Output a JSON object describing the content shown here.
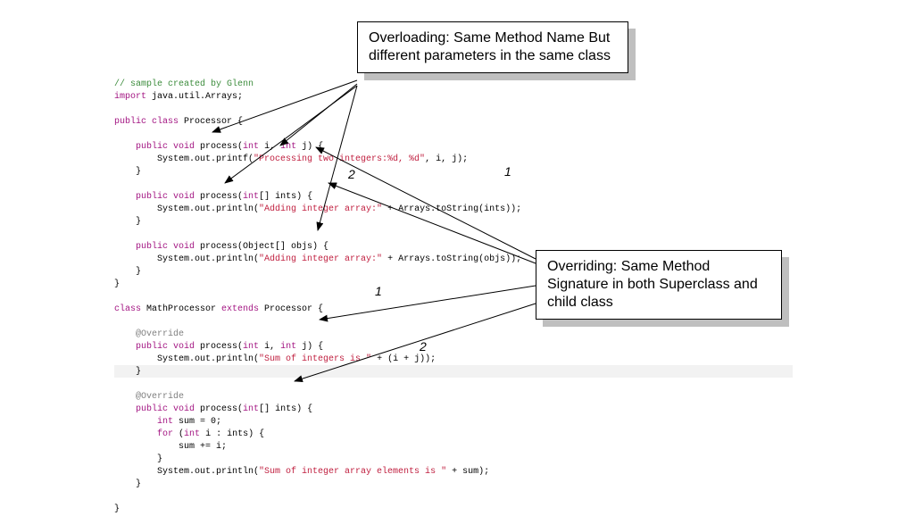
{
  "callouts": {
    "overloading": "Overloading: Same Method Name But different parameters in the same class",
    "overriding": "Overriding: Same Method Signature in both Superclass and child class"
  },
  "labels": {
    "arrow1a": "1",
    "arrow2a": "2",
    "arrow1b": "1",
    "arrow2b": "2"
  },
  "code": {
    "l1_comment": "// sample created by Glenn",
    "l2_import": "import",
    "l2_pkg": " java.util.Arrays;",
    "l4_pub": "public",
    "l4_class": " class",
    "l4_name": " Processor {",
    "l6_pub": "    public",
    "l6_void": " void",
    "l6_sig": " process(",
    "l6_int1": "int",
    "l6_p1": " i, ",
    "l6_int2": "int",
    "l6_p2": " j) {",
    "l7_pre": "        System.out.printf(",
    "l7_str": "\"Processing two integers:%d, %d\"",
    "l7_post": ", i, j);",
    "l8_close": "    }",
    "l10_pub": "    public",
    "l10_void": " void",
    "l10_sig": " process(",
    "l10_int": "int",
    "l10_arr": "[] ints) {",
    "l11_pre": "        System.out.println(",
    "l11_str": "\"Adding integer array:\"",
    "l11_post": " + Arrays.toString(ints));",
    "l12_close": "    }",
    "l14_pub": "    public",
    "l14_void": " void",
    "l14_sig": " process(Object[] objs) {",
    "l15_pre": "        System.out.println(",
    "l15_str": "\"Adding integer array:\"",
    "l15_post": " + Arrays.toString(objs));",
    "l16_close": "    }",
    "l17_close": "}",
    "l19_class": "class",
    "l19_name": " MathProcessor ",
    "l19_ext": "extends",
    "l19_sup": " Processor {",
    "l21_ann": "    @Override",
    "l22_pub": "    public",
    "l22_void": " void",
    "l22_sig": " process(",
    "l22_int1": "int",
    "l22_p1": " i, ",
    "l22_int2": "int",
    "l22_p2": " j) {",
    "l23_pre": "        System.out.println(",
    "l23_str": "\"Sum of integers is \"",
    "l23_post": " + (i + j));",
    "l24_close": "    }",
    "l26_ann": "    @Override",
    "l27_pub": "    public",
    "l27_void": " void",
    "l27_sig": " process(",
    "l27_int": "int",
    "l27_arr": "[] ints) {",
    "l28_pre": "        ",
    "l28_int": "int",
    "l28_post": " sum = 0;",
    "l29_pre": "        ",
    "l29_for": "for",
    "l29_open": " (",
    "l29_int": "int",
    "l29_post": " i : ints) {",
    "l30_body": "            sum += i;",
    "l31_close": "        }",
    "l32_pre": "        System.out.println(",
    "l32_str": "\"Sum of integer array elements is \"",
    "l32_post": " + sum);",
    "l33_close": "    }",
    "l35_close": "}"
  }
}
